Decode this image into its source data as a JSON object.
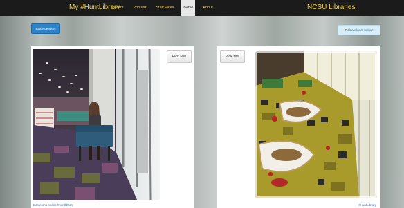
{
  "navbar": {
    "brand": "My #HuntLibrary",
    "links": [
      "Recent",
      "Popular",
      "Staff Picks",
      "Battle",
      "About"
    ],
    "active": "Battle",
    "right_brand": "NCSU Libraries"
  },
  "actions": {
    "leaders_button": "Battle Leaders",
    "banner": "Pick a winner below!"
  },
  "panels": {
    "left": {
      "pick_label": "Pick Me!",
      "caption": "Barcelona chairs #huntlibrary"
    },
    "right": {
      "pick_label": "Pick Me!",
      "caption": "#HuntLibrary"
    }
  },
  "colors": {
    "navbar": "#1b1b1b",
    "brand_text": "#f5d23a",
    "primary_button": "#2a84cc",
    "link": "#2d6fb5"
  }
}
